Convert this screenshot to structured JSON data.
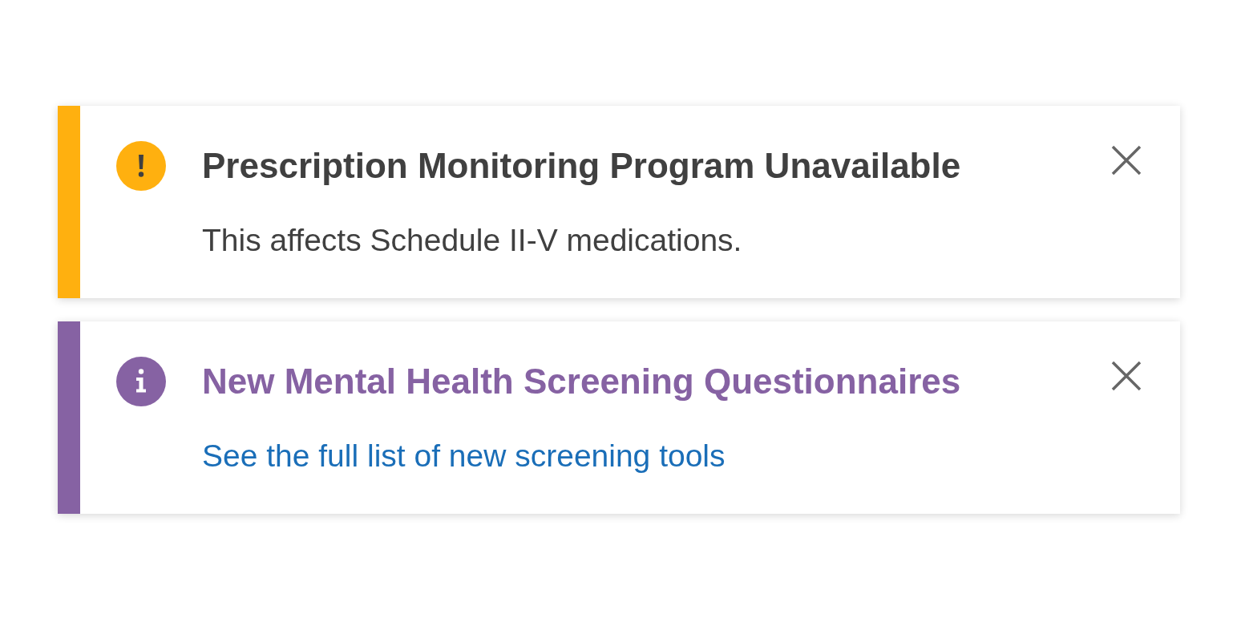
{
  "alerts": [
    {
      "kind": "warning",
      "color": "#ffb00f",
      "title": "Prescription Monitoring Program Unavailable",
      "body": {
        "kind": "text",
        "text": "This affects Schedule II-V medications."
      }
    },
    {
      "kind": "info",
      "color": "#8662a3",
      "title": "New Mental Health Screening Questionnaires",
      "body": {
        "kind": "link",
        "text": "See the full list of new screening tools"
      }
    }
  ]
}
